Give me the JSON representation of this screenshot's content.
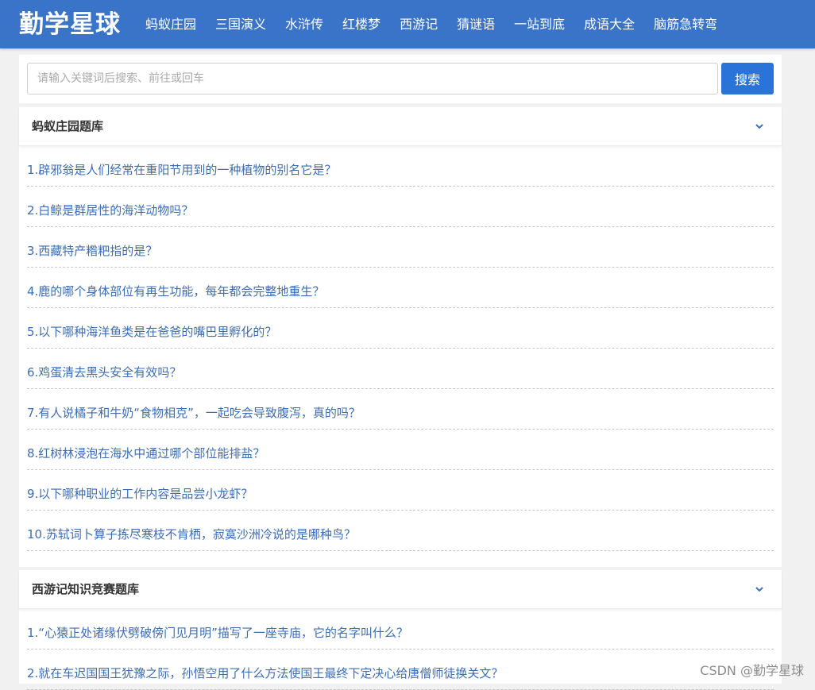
{
  "header": {
    "logo": "勤学星球",
    "nav": [
      "蚂蚁庄园",
      "三国演义",
      "水浒传",
      "红楼梦",
      "西游记",
      "猜谜语",
      "一站到底",
      "成语大全",
      "脑筋急转弯"
    ]
  },
  "search": {
    "placeholder": "请输入关键词后搜索、前往或回车",
    "button": "搜索"
  },
  "sections": [
    {
      "title": "蚂蚁庄园题库",
      "questions": [
        "1.辟邪翁是人们经常在重阳节用到的一种植物的别名它是？",
        "2.白鲸是群居性的海洋动物吗？",
        "3.西藏特产糌粑指的是？",
        "4.鹿的哪个身体部位有再生功能，每年都会完整地重生？",
        "5.以下哪种海洋鱼类是在爸爸的嘴巴里孵化的？",
        "6.鸡蛋清去黑头安全有效吗？",
        "7.有人说橘子和牛奶“食物相克”，一起吃会导致腹泻，真的吗？",
        "8.红树林浸泡在海水中通过哪个部位能排盐？",
        "9.以下哪种职业的工作内容是品尝小龙虾？",
        "10.苏轼词卜算子拣尽寒枝不肯栖，寂寞沙洲冷说的是哪种鸟？"
      ]
    },
    {
      "title": "西游记知识竞赛题库",
      "questions": [
        "1.“心猿正处诸缘伏劈破傍门见月明”描写了一座寺庙，它的名字叫什么？",
        "2.就在车迟国国王犹豫之际，孙悟空用了什么方法使国王最终下定决心给唐僧师徒换关文？"
      ]
    }
  ],
  "watermark": "CSDN @勤学星球",
  "colors": {
    "header": "#3a74c8",
    "button": "#2a73d9",
    "link": "#3b6db6"
  }
}
